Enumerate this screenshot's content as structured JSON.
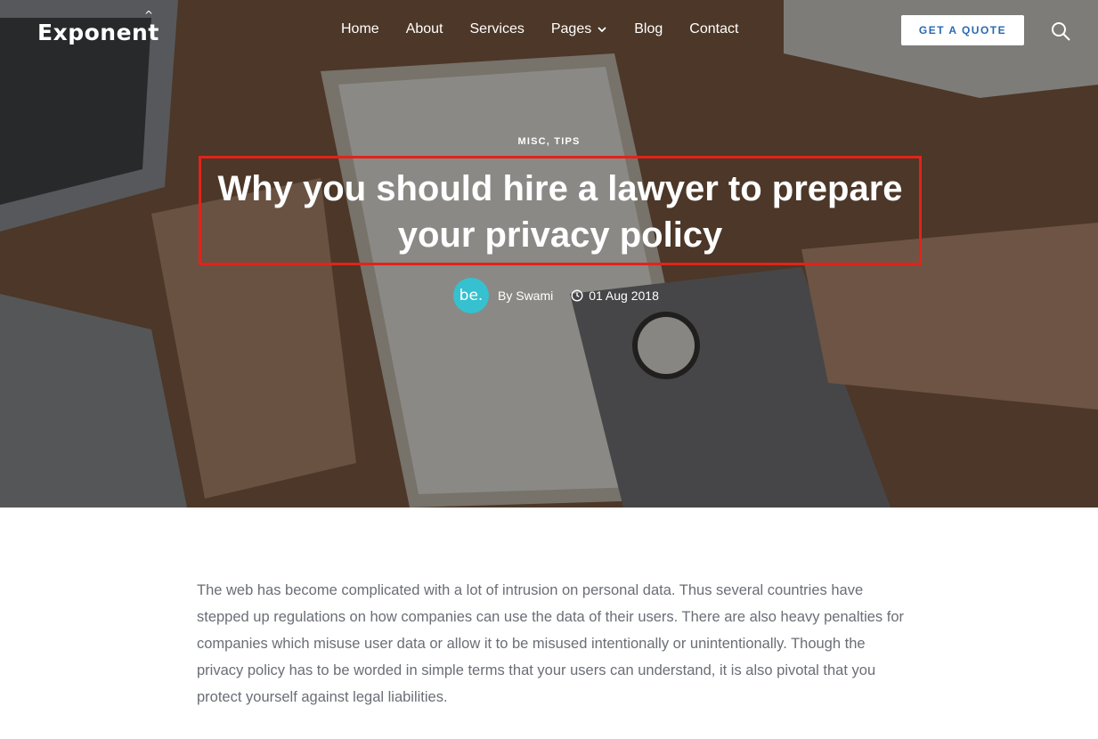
{
  "header": {
    "logo": "Exponent",
    "nav": [
      {
        "label": "Home"
      },
      {
        "label": "About"
      },
      {
        "label": "Services"
      },
      {
        "label": "Pages"
      },
      {
        "label": "Blog"
      },
      {
        "label": "Contact"
      }
    ],
    "cta_label": "GET A QUOTE"
  },
  "post": {
    "categories": "MISC, TIPS",
    "title": "Why you should hire a lawyer to prepare your privacy policy",
    "avatar_text": "be.",
    "author": "By Swami",
    "date": "01 Aug 2018",
    "body": "The web has become complicated with a lot of intrusion on personal data. Thus several countries have stepped up regulations on how companies can use the data of their users. There are also heavy penalties for companies which misuse user data or allow it to be misused intentionally or unintentionally. Though the privacy policy has to be worded in simple terms that your users can understand, it is also pivotal that you protect yourself against legal liabilities."
  },
  "colors": {
    "highlight_border": "#e2231a",
    "avatar_bg": "#35c1cf",
    "cta_text": "#2a6ab3",
    "body_text": "#6a6e75"
  },
  "icons": {
    "search": "search-icon",
    "clock": "clock-icon",
    "dropdown": "chevron-down-icon"
  }
}
